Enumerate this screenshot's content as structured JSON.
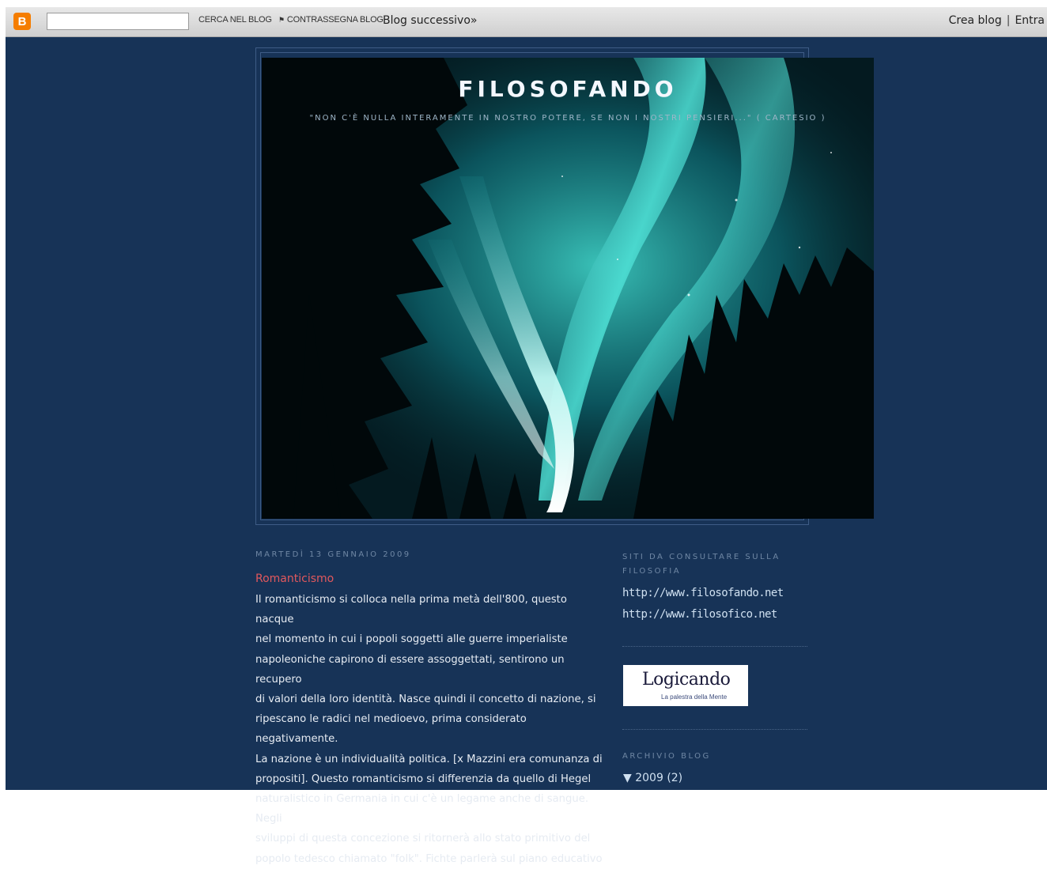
{
  "navbar": {
    "logo_letter": "B",
    "search_value": "",
    "search_blog_label": "CERCA NEL BLOG",
    "flag_blog_label": "CONTRASSEGNA BLOG",
    "next_blog_label": "Blog successivo»",
    "create_blog_label": "Crea blog",
    "separator": "|",
    "login_label": "Entra"
  },
  "header": {
    "title": "FILOSOFANDO",
    "description": "\"NON C'È NULLA INTERAMENTE IN NOSTRO POTERE, SE NON I NOSTRI PENSIERI...\" ( CARTESIO )"
  },
  "post": {
    "date": "MARTEDÌ 13 GENNAIO 2009",
    "title": "Romanticismo",
    "body_lines": [
      "Il romanticismo si colloca nella prima metà dell'800, questo nacque",
      "nel momento in cui i popoli soggetti alle guerre imperialiste",
      "napoleoniche capirono di essere assoggettati, sentirono un recupero",
      "di valori della loro identità. Nasce quindi il concetto di nazione, si",
      "ripescano le radici nel medioevo, prima considerato negativamente.",
      "La nazione è un individualità politica. [x Mazzini era comunanza di",
      "propositi]. Questo romanticismo si differenzia da quello di Hegel",
      "naturalistico in Germania in cui c'è un legame anche di sangue. Negli",
      "sviluppi di questa concezione si ritornerà allo stato primitivo del",
      "popolo tedesco chiamato \"folk\". Fichte parlerà sul piano educativo"
    ]
  },
  "sidebar": {
    "links_heading": "SITI DA CONSULTARE SULLA FILOSOFIA",
    "links": [
      "http://www.filosofando.net",
      "http://www.filosofico.net"
    ],
    "logo_text": "Logicando",
    "logo_subtitle": "La palestra della Mente",
    "archive_heading": "ARCHIVIO BLOG",
    "archive_year": "▼ 2009",
    "archive_count": "(2)"
  },
  "colors": {
    "page_background": "#173357",
    "post_title": "#e2585d",
    "accent_orange": "#f57d00"
  }
}
